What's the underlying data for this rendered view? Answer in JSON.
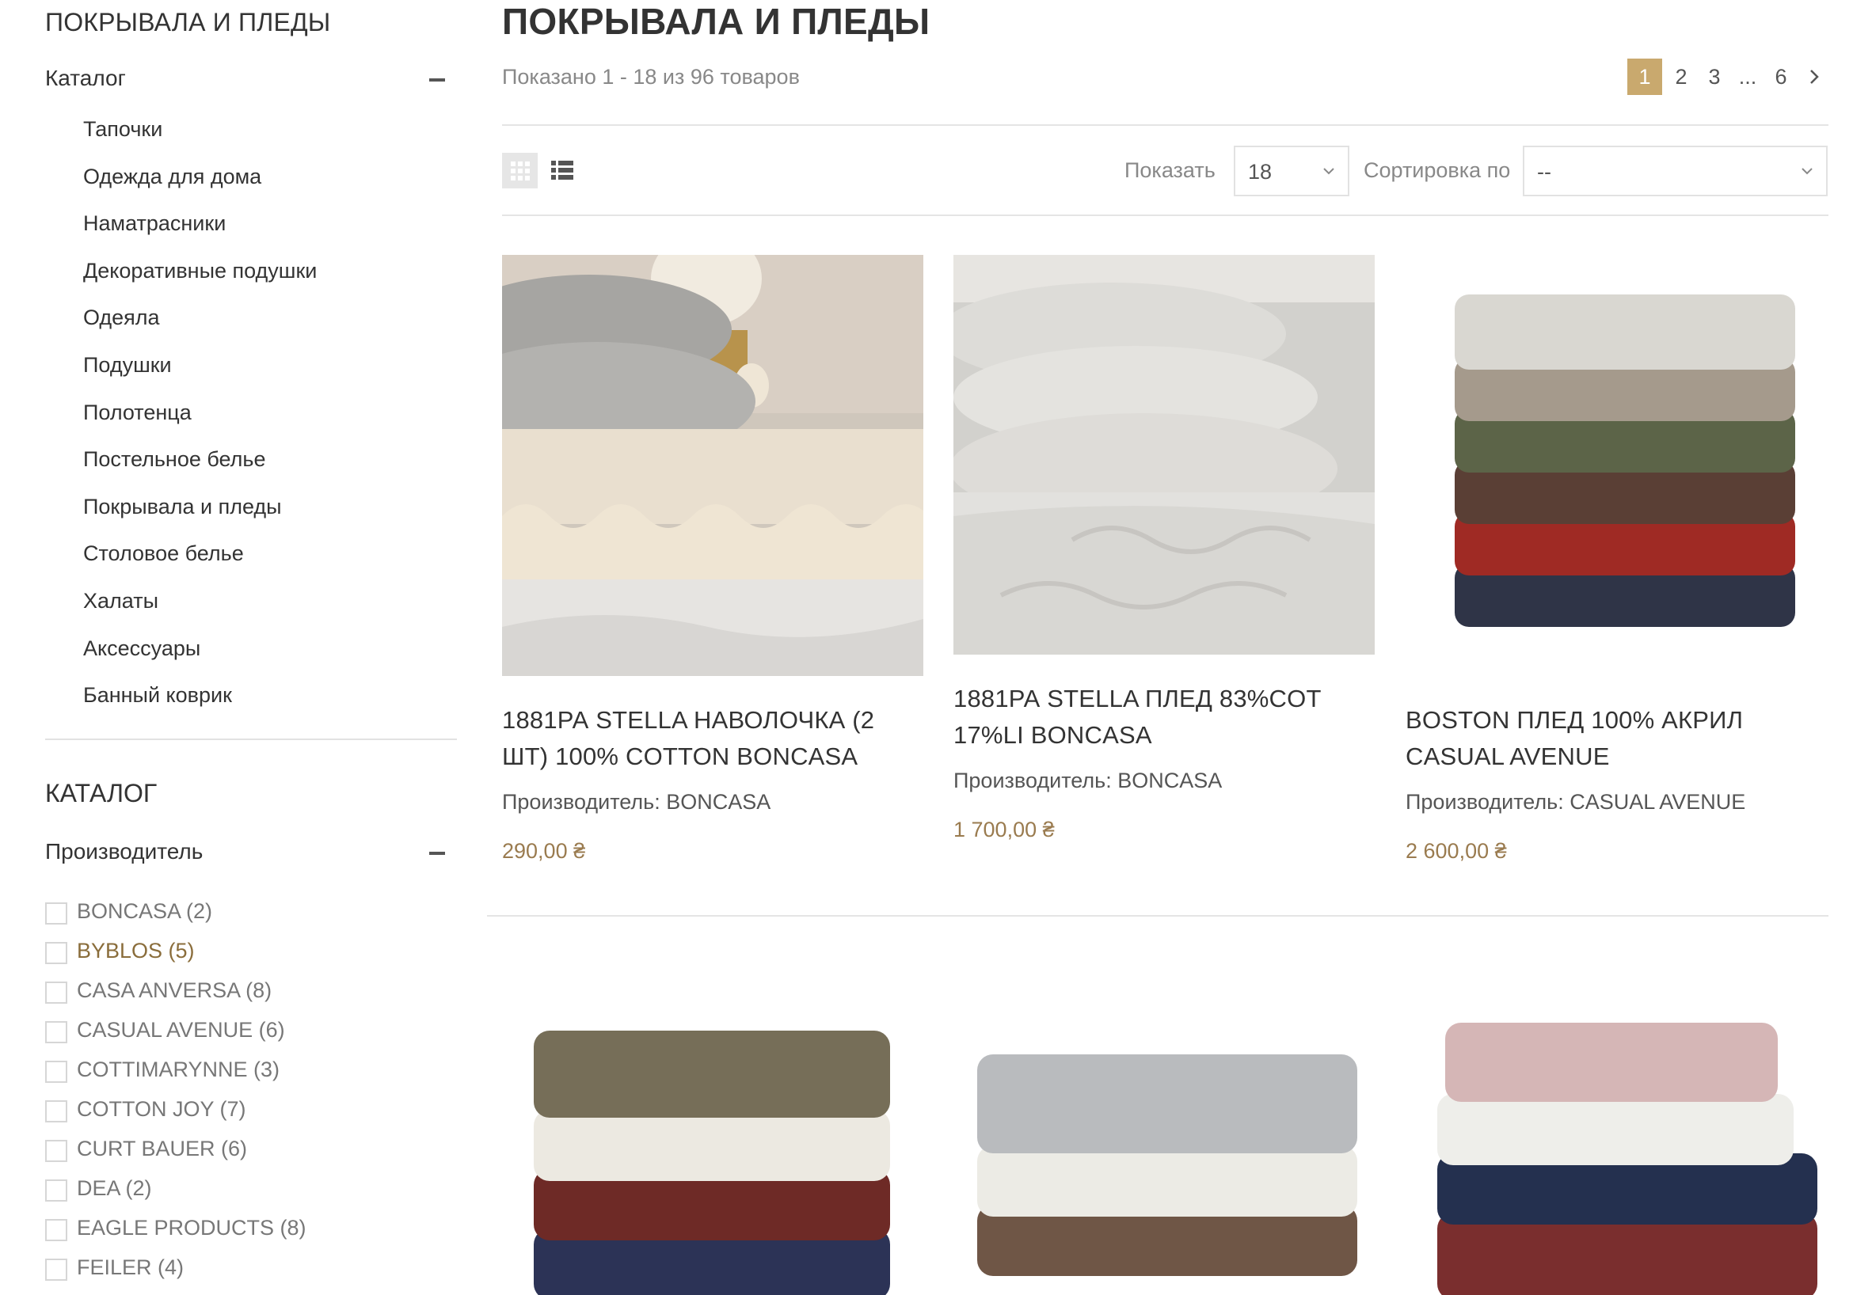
{
  "sidebar": {
    "title": "ПОКРЫВАЛА И ПЛЕДЫ",
    "catalog_label": "Каталог",
    "categories": [
      "Тапочки",
      "Одежда для дома",
      "Наматрасники",
      "Декоративные подушки",
      "Одеяла",
      "Подушки",
      "Полотенца",
      "Постельное белье",
      "Покрывала и пледы",
      "Столовое белье",
      "Халаты",
      "Аксессуары",
      "Банный коврик"
    ],
    "filter_title": "КАТАЛОГ",
    "manufacturer_label": "Производитель",
    "manufacturers": [
      "BONCASA (2)",
      "BYBLOS (5)",
      "CASA ANVERSA (8)",
      "CASUAL AVENUE (6)",
      "COTTIMARYNNE (3)",
      "COTTON JOY (7)",
      "CURT BAUER (6)",
      "DEA (2)",
      "EAGLE PRODUCTS (8)",
      "FEILER (4)"
    ]
  },
  "main": {
    "title": "ПОКРЫВАЛА И ПЛЕДЫ",
    "count_text": "Показано 1 - 18 из 96 товаров",
    "pagination": {
      "pages": [
        "1",
        "2",
        "3",
        "...",
        "6"
      ],
      "current": "1",
      "next_icon": "chevron-right-icon"
    },
    "toolbar": {
      "grid_icon": "grid-view-icon",
      "list_icon": "list-view-icon",
      "show_label": "Показать",
      "show_value": "18",
      "sort_label": "Сортировка по",
      "sort_value": "--"
    },
    "products": [
      {
        "name": "1881РА STELLA НАВОЛОЧКА (2 ШТ) 100% COTTON BONCASA",
        "manufacturer": "Производитель: BONCASA",
        "price": "290,00 ₴"
      },
      {
        "name": "1881РА STELLA ПЛЕД 83%COT 17%LI BONCASA",
        "manufacturer": "Производитель: BONCASA",
        "price": "1 700,00 ₴"
      },
      {
        "name": "BOSTON ПЛЕД 100% АКРИЛ CASUAL AVENUE",
        "manufacturer": "Производитель: CASUAL AVENUE",
        "price": "2 600,00 ₴"
      }
    ]
  },
  "colors": {
    "accent_gold": "#c9a96e",
    "price": "#9a7b4f",
    "active_filter": "#8a6d3b"
  }
}
